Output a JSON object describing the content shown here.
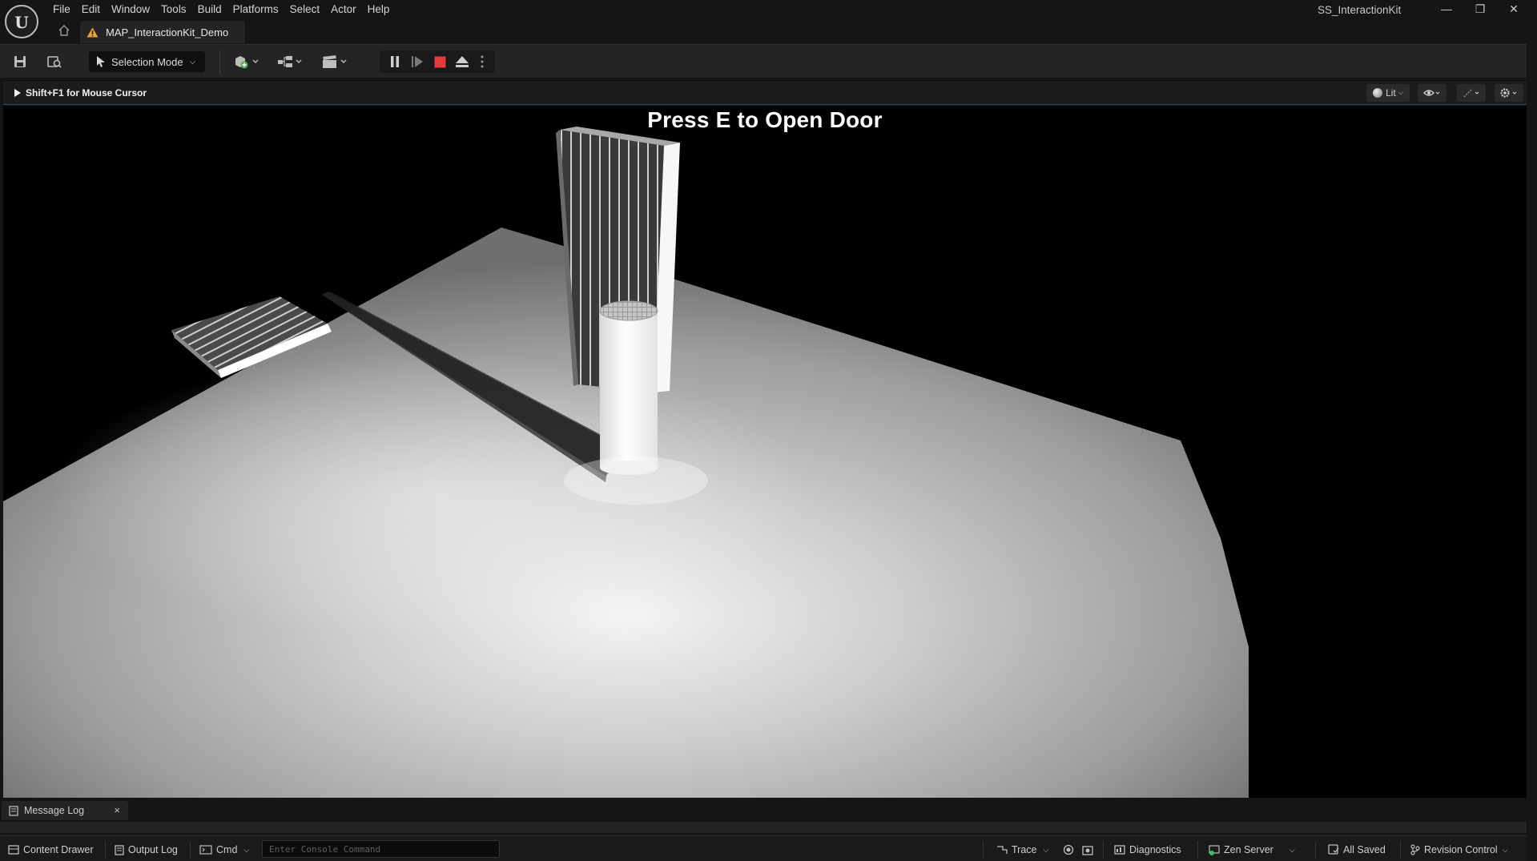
{
  "window": {
    "project_name": "SS_InteractionKit",
    "controls": {
      "minimize": "—",
      "restore": "❐",
      "close": "✕"
    }
  },
  "menu": [
    "File",
    "Edit",
    "Window",
    "Tools",
    "Build",
    "Platforms",
    "Select",
    "Actor",
    "Help"
  ],
  "document_tab": {
    "label": "MAP_InteractionKit_Demo",
    "status_color": "#e8a33a"
  },
  "toolbar": {
    "selection_mode": "Selection Mode",
    "icons": [
      "save-icon",
      "browse-icon",
      "add-actor-icon",
      "blueprint-icon",
      "cinematics-icon",
      "pause-icon",
      "frame-skip-icon",
      "stop-icon",
      "eject-icon",
      "more-options-icon"
    ],
    "stop_color": "#e33b3b"
  },
  "viewport_bar": {
    "hint": "Shift+F1 for Mouse Cursor",
    "view_mode": "Lit"
  },
  "hud": {
    "prompt": "Press E to Open Door"
  },
  "message_log": {
    "tab_label": "Message Log",
    "close": "×"
  },
  "statusbar": {
    "content_drawer": "Content Drawer",
    "output_log": "Output Log",
    "cmd": "Cmd",
    "console_placeholder": "Enter Console Command",
    "trace": "Trace",
    "diagnostics": "Diagnostics",
    "zen_server": "Zen Server",
    "all_saved": "All Saved",
    "revision_control": "Revision Control"
  },
  "colors": {
    "accent": "#2a6fb0",
    "zen_green": "#3fbf5a"
  }
}
